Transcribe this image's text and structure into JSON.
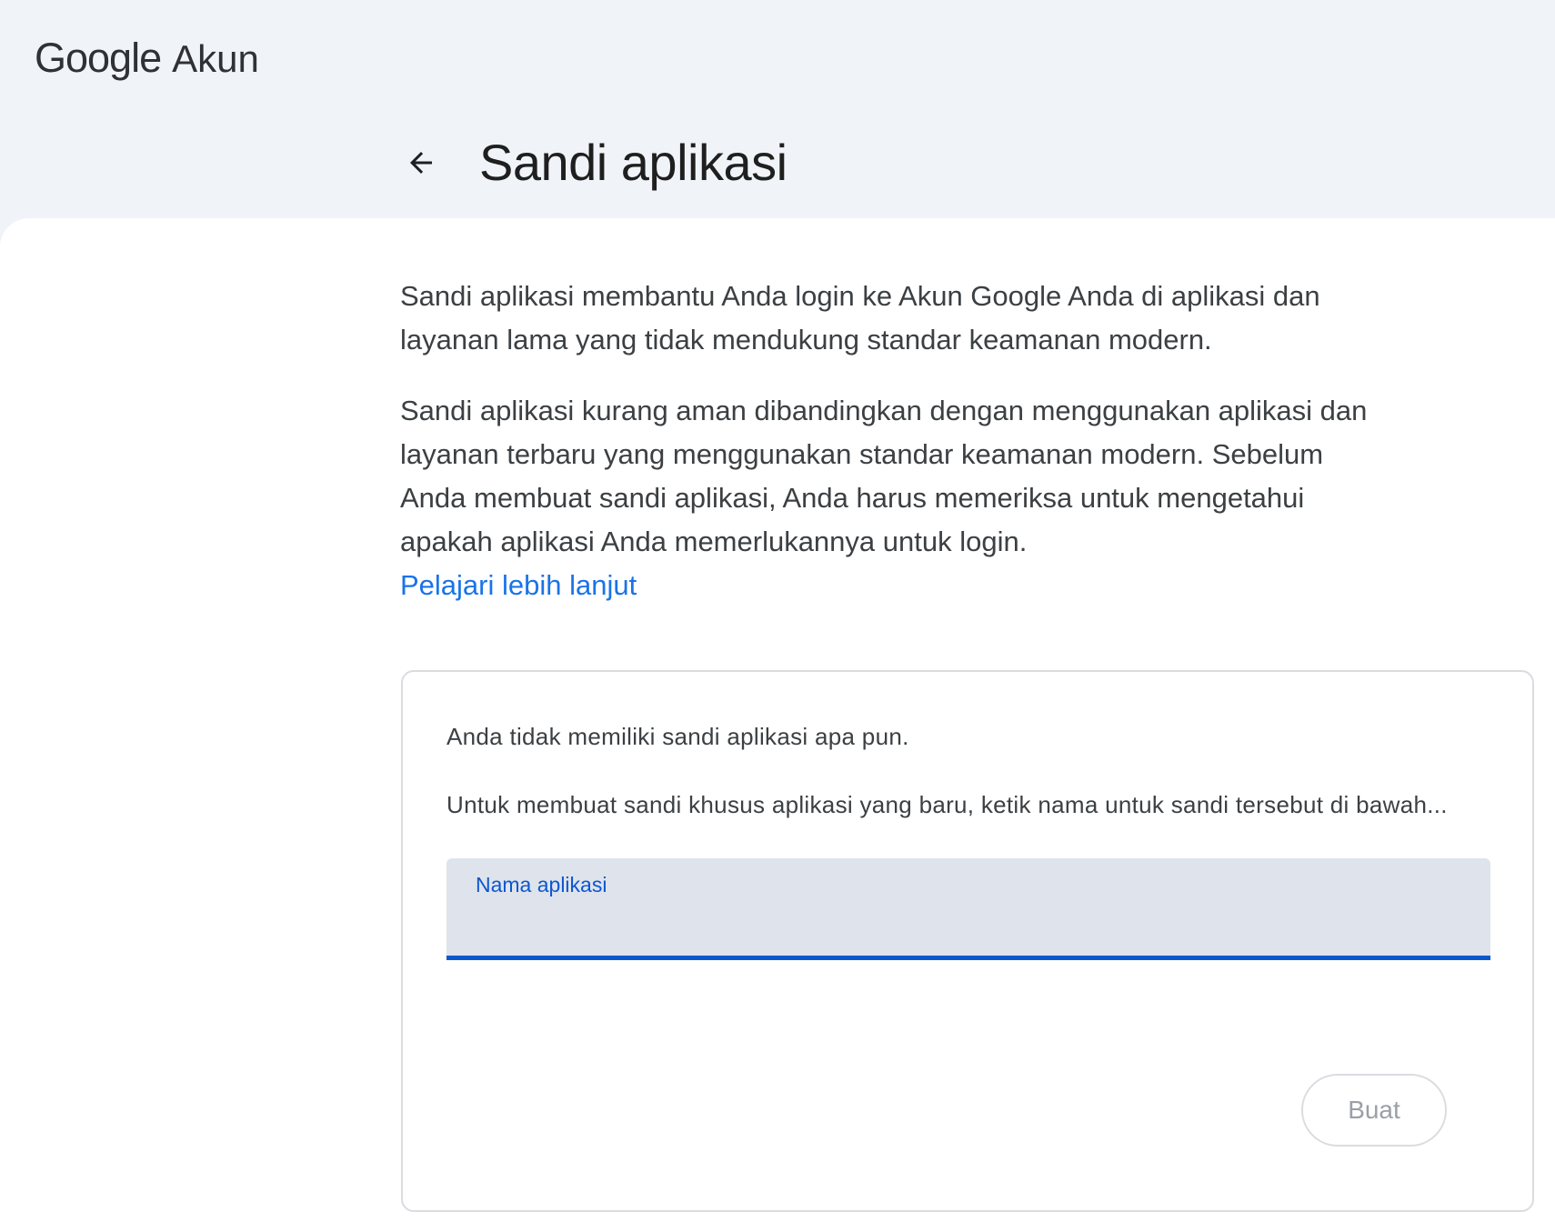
{
  "header": {
    "brand_google": "Google",
    "brand_product": "Akun"
  },
  "page": {
    "title": "Sandi aplikasi",
    "back_icon": "arrow-back-icon"
  },
  "intro": {
    "paragraph1": "Sandi aplikasi membantu Anda login ke Akun Google Anda di aplikasi dan layanan lama yang tidak mendukung standar keamanan modern.",
    "paragraph2": "Sandi aplikasi kurang aman dibandingkan dengan menggunakan aplikasi dan layanan terbaru yang menggunakan standar keamanan modern. Sebelum Anda membuat sandi aplikasi, Anda harus memeriksa untuk mengetahui apakah aplikasi Anda memerlukannya untuk login.",
    "learn_more": "Pelajari lebih lanjut"
  },
  "card": {
    "empty_message": "Anda tidak memiliki sandi aplikasi apa pun.",
    "instruction": "Untuk membuat sandi khusus aplikasi yang baru, ketik nama untuk sandi tersebut di bawah...",
    "field_label": "Nama aplikasi",
    "field_value": "",
    "create_button": "Buat"
  },
  "colors": {
    "accent": "#0b57d0",
    "link": "#1a73e8",
    "header_bg": "#f0f4f9",
    "field_bg": "#dfe3eb"
  }
}
